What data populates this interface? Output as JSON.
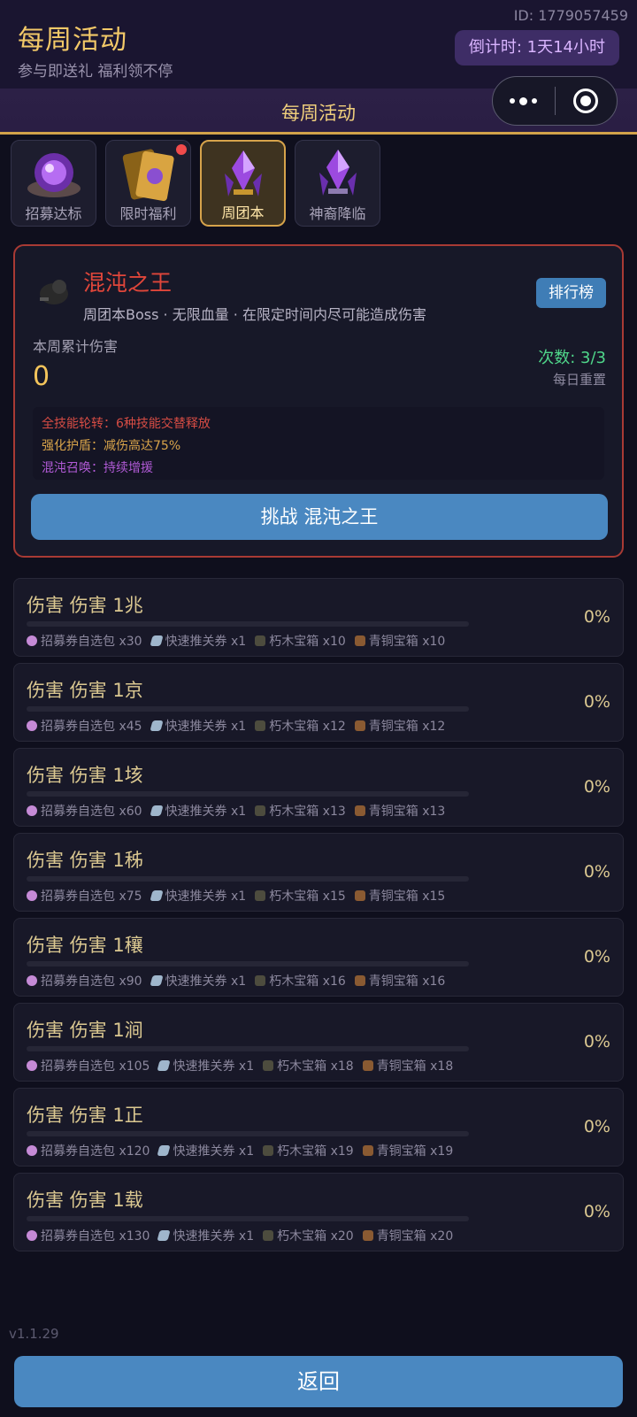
{
  "header": {
    "title": "每周活动",
    "subtitle": "参与即送礼 福利领不停",
    "user_id": "ID: 1779057459",
    "countdown": "倒计时: 1天14小时"
  },
  "section": {
    "title": "每周活动"
  },
  "tabs": [
    {
      "label": "招募达标",
      "icon": "purple-orb-icon",
      "active": false,
      "badge": false
    },
    {
      "label": "限时福利",
      "icon": "gold-cards-icon",
      "active": false,
      "badge": true
    },
    {
      "label": "周团本",
      "icon": "purple-crystal-icon",
      "active": true,
      "badge": false
    },
    {
      "label": "神裔降临",
      "icon": "purple-crystal-icon",
      "active": false,
      "badge": false
    }
  ],
  "boss": {
    "name": "混沌之王",
    "desc": "周团本Boss · 无限血量 · 在限定时间内尽可能造成伤害",
    "rank_label": "排行榜",
    "damage_label": "本周累计伤害",
    "damage_value": "0",
    "attempts": "次数: 3/3",
    "reset": "每日重置",
    "skills": [
      "全技能轮转：6种技能交替释放",
      "强化护盾：减伤高达75%",
      "混沌召唤：持续增援"
    ],
    "challenge_label": "挑战 混沌之王",
    "colors": {
      "name": "#e0463a",
      "border": "#a83a34",
      "attempts": "#4fd68a"
    }
  },
  "rewards": [
    {
      "title": "伤害 伤害 1兆",
      "progress": 0,
      "percent": "0%",
      "items": [
        "招募券自选包 x30",
        "快速推关券 x1",
        "朽木宝箱 x10",
        "青铜宝箱 x10"
      ]
    },
    {
      "title": "伤害 伤害 1京",
      "progress": 0,
      "percent": "0%",
      "items": [
        "招募券自选包 x45",
        "快速推关券 x1",
        "朽木宝箱 x12",
        "青铜宝箱 x12"
      ]
    },
    {
      "title": "伤害 伤害 1垓",
      "progress": 0,
      "percent": "0%",
      "items": [
        "招募券自选包 x60",
        "快速推关券 x1",
        "朽木宝箱 x13",
        "青铜宝箱 x13"
      ]
    },
    {
      "title": "伤害 伤害 1秭",
      "progress": 0,
      "percent": "0%",
      "items": [
        "招募券自选包 x75",
        "快速推关券 x1",
        "朽木宝箱 x15",
        "青铜宝箱 x15"
      ]
    },
    {
      "title": "伤害 伤害 1穰",
      "progress": 0,
      "percent": "0%",
      "items": [
        "招募券自选包 x90",
        "快速推关券 x1",
        "朽木宝箱 x16",
        "青铜宝箱 x16"
      ]
    },
    {
      "title": "伤害 伤害 1涧",
      "progress": 0,
      "percent": "0%",
      "items": [
        "招募券自选包 x105",
        "快速推关券 x1",
        "朽木宝箱 x18",
        "青铜宝箱 x18"
      ]
    },
    {
      "title": "伤害 伤害 1正",
      "progress": 0,
      "percent": "0%",
      "items": [
        "招募券自选包 x120",
        "快速推关券 x1",
        "朽木宝箱 x19",
        "青铜宝箱 x19"
      ]
    },
    {
      "title": "伤害 伤害 1载",
      "progress": 0,
      "percent": "0%",
      "items": [
        "招募券自选包 x130",
        "快速推关券 x1",
        "朽木宝箱 x20",
        "青铜宝箱 x20"
      ]
    }
  ],
  "reward_item_icons": [
    "ticket-icon",
    "scroll-icon",
    "wood-chest-icon",
    "bronze-chest-icon"
  ],
  "footer": {
    "version": "v1.1.29",
    "back_label": "返回"
  },
  "colors": {
    "accent_gold": "#d6a34b",
    "button_blue": "#4a88c1",
    "background": "#0f0f1d"
  }
}
